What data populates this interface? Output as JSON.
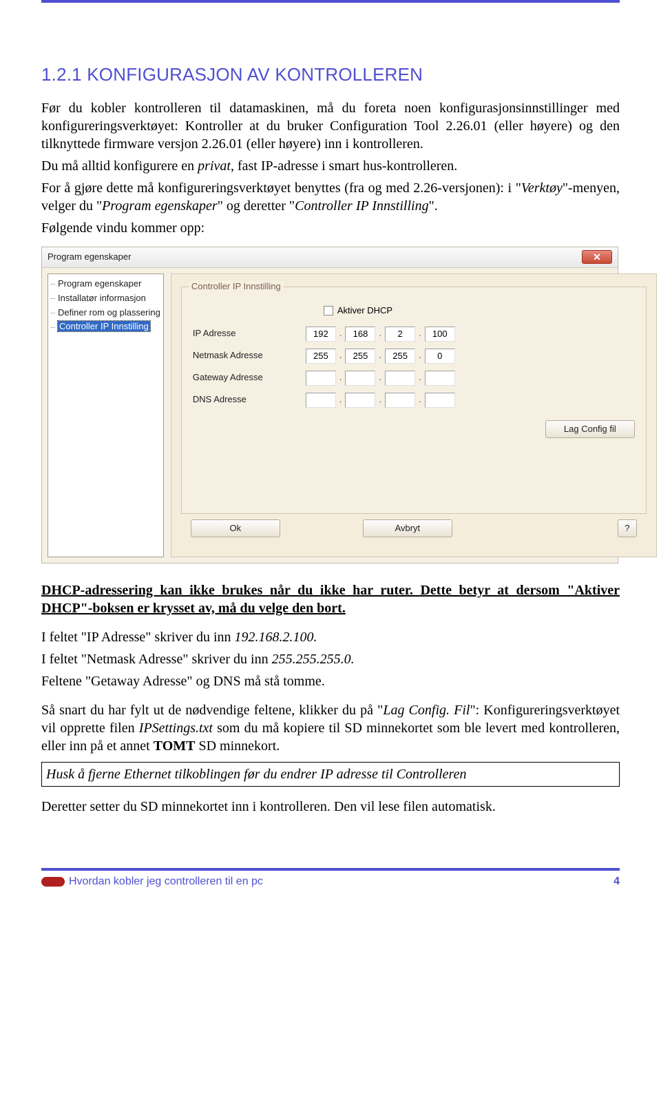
{
  "rule_top": true,
  "heading": "1.2.1 KONFIGURASJON AV KONTROLLEREN",
  "para1_a": "Før du kobler kontrolleren til datamaskinen, må du foreta noen konfigurasjonsinnstillinger med konfigureringsverktøyet: Kontroller at du bruker Configuration Tool 2.26.01 (eller høyere) og den tilknyttede firmware versjon 2.26.01 (eller høyere) inn i kontrolleren.",
  "para1_b_prefix": "Du må alltid konfigurere en ",
  "para1_b_it": "privat",
  "para1_b_suffix": ", fast IP-adresse i smart hus-kontrolleren.",
  "para2_prefix": "For å gjøre dette må konfigureringsverktøyet benyttes (fra og med 2.26-versjonen): i \"",
  "para2_it1": "Verktøy",
  "para2_mid": "\"-menyen, velger du \"",
  "para2_it2": "Program egenskaper",
  "para2_mid2": "\" og deretter \"",
  "para2_it3": "Controller IP Innstilling",
  "para2_suffix": "\".",
  "para3": "Følgende vindu kommer opp:",
  "dialog": {
    "title": "Program egenskaper",
    "tree": [
      "Program egenskaper",
      "Installatør informasjon",
      "Definer rom og plassering",
      "Controller IP Innstilling"
    ],
    "tree_selected_index": 3,
    "group_title": "Controller IP Innstilling",
    "dhcp_label": "Aktiver DHCP",
    "rows": [
      {
        "label": "IP Adresse",
        "octets": [
          "192",
          "168",
          "2",
          "100"
        ]
      },
      {
        "label": "Netmask Adresse",
        "octets": [
          "255",
          "255",
          "255",
          "0"
        ]
      },
      {
        "label": "Gateway Adresse",
        "octets": [
          "",
          "",
          "",
          ""
        ]
      },
      {
        "label": "DNS Adresse",
        "octets": [
          "",
          "",
          "",
          ""
        ]
      }
    ],
    "btn_config": "Lag Config fil",
    "btn_ok": "Ok",
    "btn_cancel": "Avbryt",
    "btn_help": "?"
  },
  "para4": "DHCP-adressering kan ikke brukes når du ikke har ruter. Dette betyr at dersom \"Aktiver DHCP\"-boksen er krysset av, må du velge den bort.",
  "para5_a": "I feltet \"IP Adresse\" skriver du inn ",
  "para5_a_it": "192.168.2.100.",
  "para5_b": "I feltet \"Netmask Adresse\" skriver du inn ",
  "para5_b_it": "255.255.255.0.",
  "para5_c": "Feltene \"Getaway Adresse\" og DNS må stå tomme.",
  "para6_a": "Så snart du har fylt ut de nødvendige feltene, klikker du på \"",
  "para6_it1": "Lag Config. Fil",
  "para6_b": "\": Konfigureringsverktøyet vil opprette filen ",
  "para6_it2": "IPSettings.txt",
  "para6_c": " som du må kopiere til SD minnekortet som ble levert med kontrolleren, eller inn på et annet ",
  "para6_bold": "TOMT",
  "para6_d": " SD minnekort.",
  "note": "Husk å fjerne Ethernet tilkoblingen før du endrer IP adresse til Controlleren",
  "para7": "Deretter setter du SD minnekortet inn i kontrolleren. Den vil lese filen automatisk.",
  "footer": {
    "text": "Hvordan kobler jeg controlleren til en pc",
    "page": "4"
  }
}
